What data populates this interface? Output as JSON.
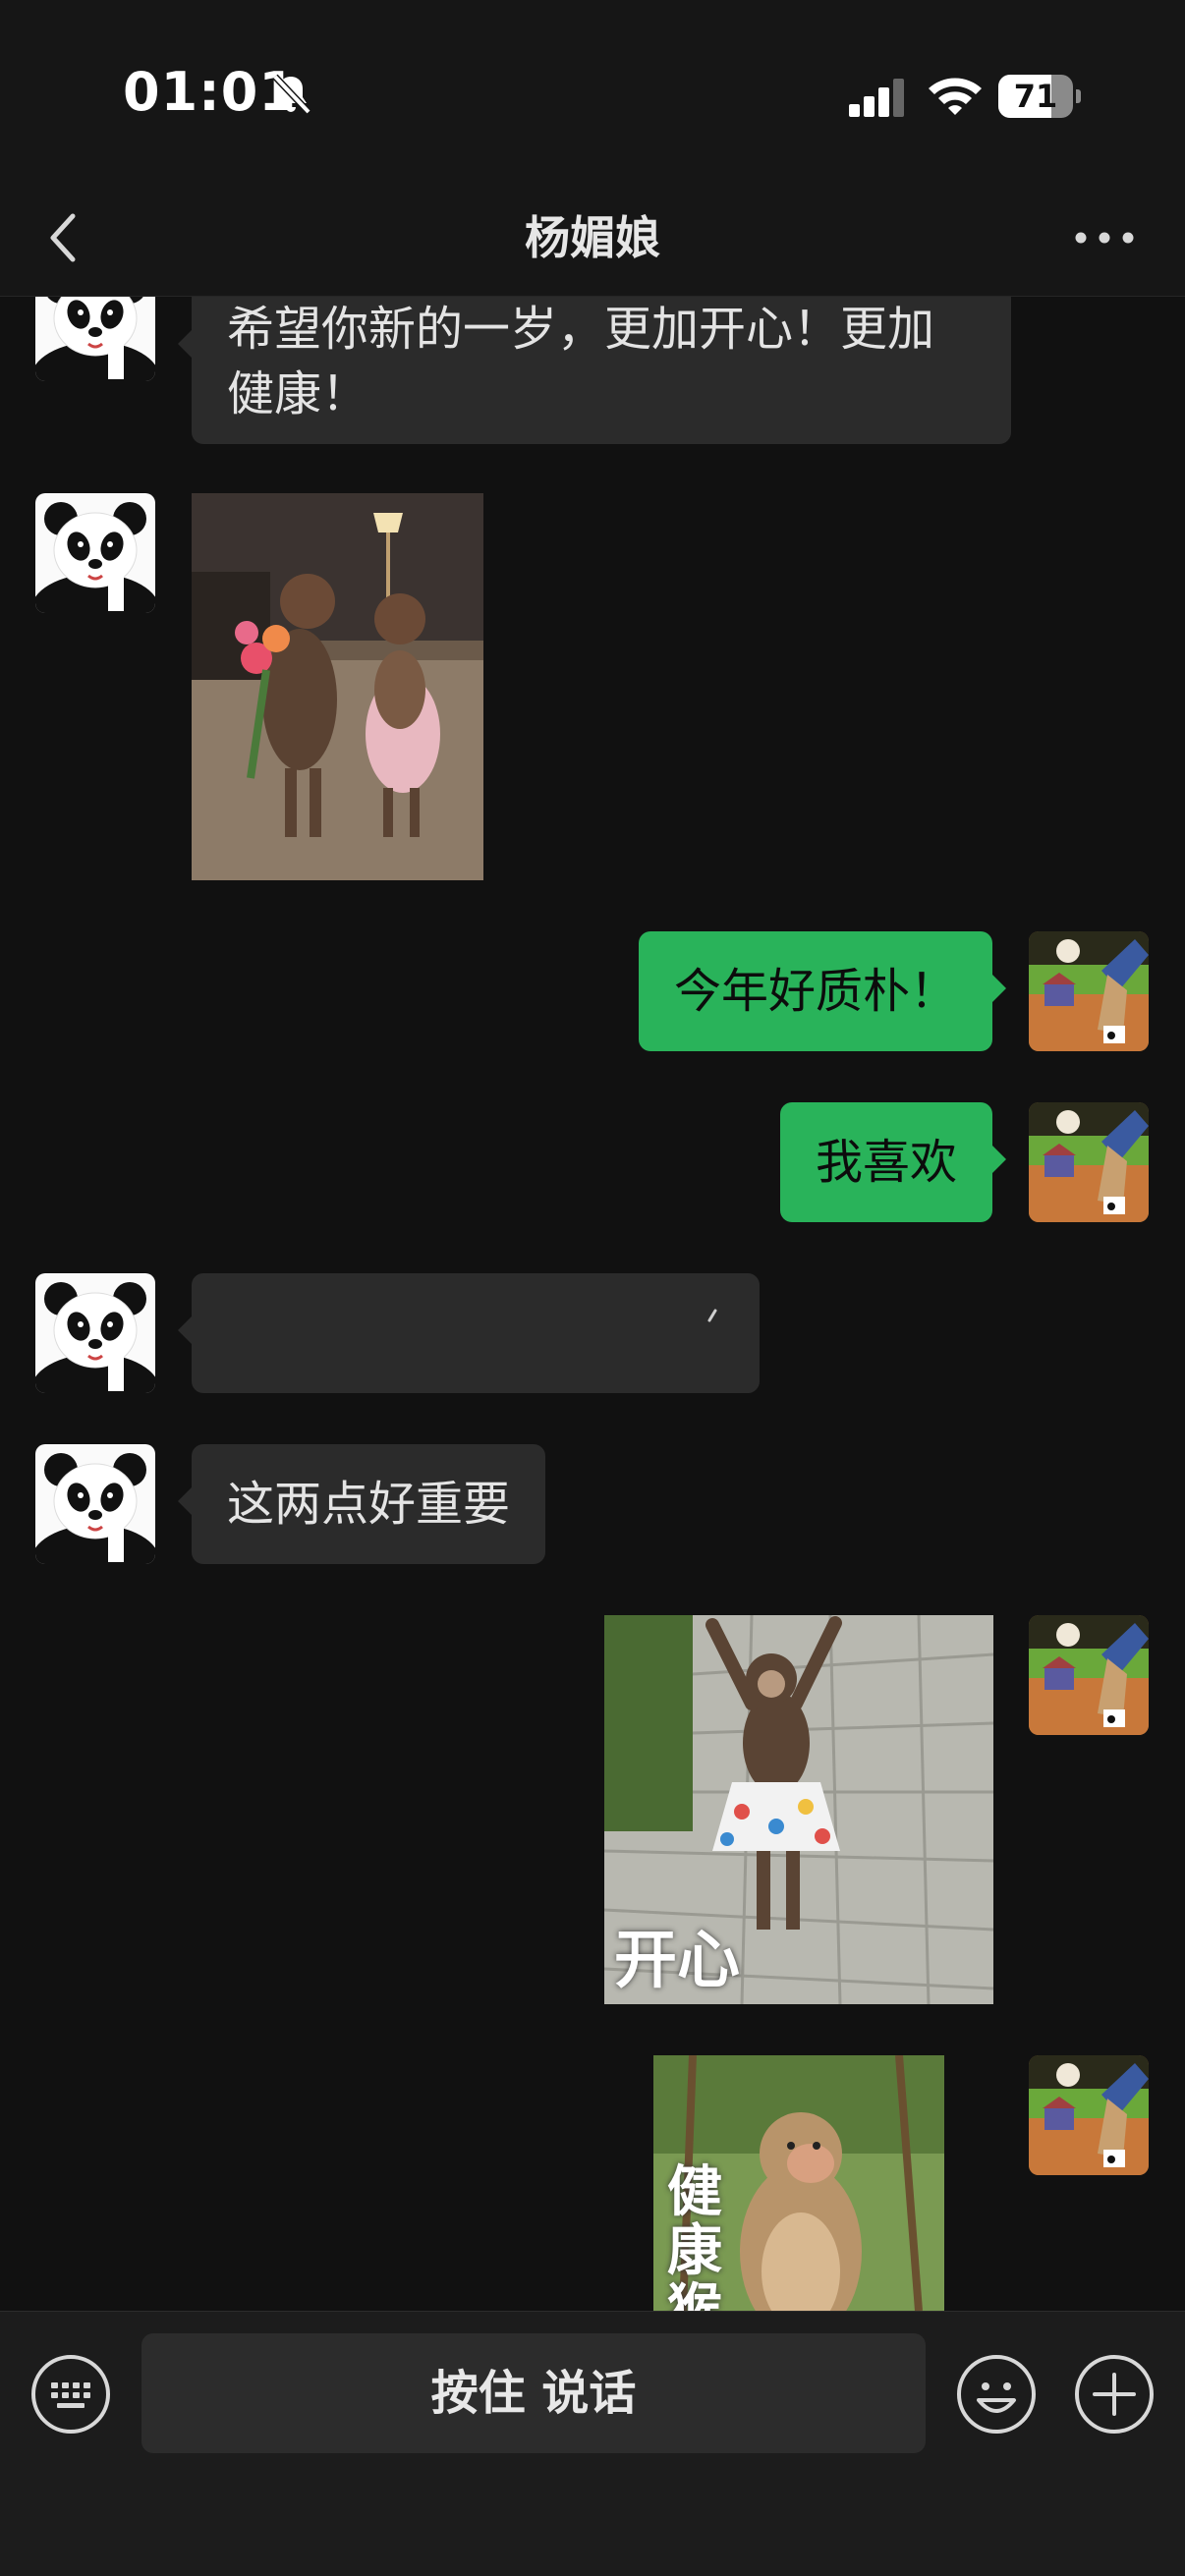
{
  "status_bar": {
    "time": "01:01",
    "battery": "71",
    "battery_level": 0.71
  },
  "header": {
    "title": "杨媚娘"
  },
  "messages": [
    {
      "side": "left",
      "type": "text",
      "text": "希望你新的一岁，更加开心！更加健康！"
    },
    {
      "side": "left",
      "type": "sticker",
      "description": "two monkeys with flowers"
    },
    {
      "side": "right",
      "type": "text",
      "text": "今年好质朴！"
    },
    {
      "side": "right",
      "type": "text",
      "text": "我喜欢"
    },
    {
      "side": "left",
      "type": "text",
      "text": ""
    },
    {
      "side": "left",
      "type": "text",
      "text": "这两点好重要"
    },
    {
      "side": "right",
      "type": "sticker",
      "caption": "开心"
    },
    {
      "side": "right",
      "type": "sticker",
      "caption": "健康猴"
    }
  ],
  "input_bar": {
    "hold_to_talk": "按住 说话"
  },
  "icons": {
    "mute": "bell-slash-icon",
    "signal": "cellular-signal-icon",
    "wifi": "wifi-icon",
    "back": "chevron-left-icon",
    "more": "ellipsis-icon",
    "keyboard": "keyboard-icon",
    "emoji": "emoji-icon",
    "plus": "plus-circle-icon"
  },
  "colors": {
    "accent_green": "#29b35a",
    "incoming_bubble": "#2b2b2b",
    "background": "#111111"
  }
}
